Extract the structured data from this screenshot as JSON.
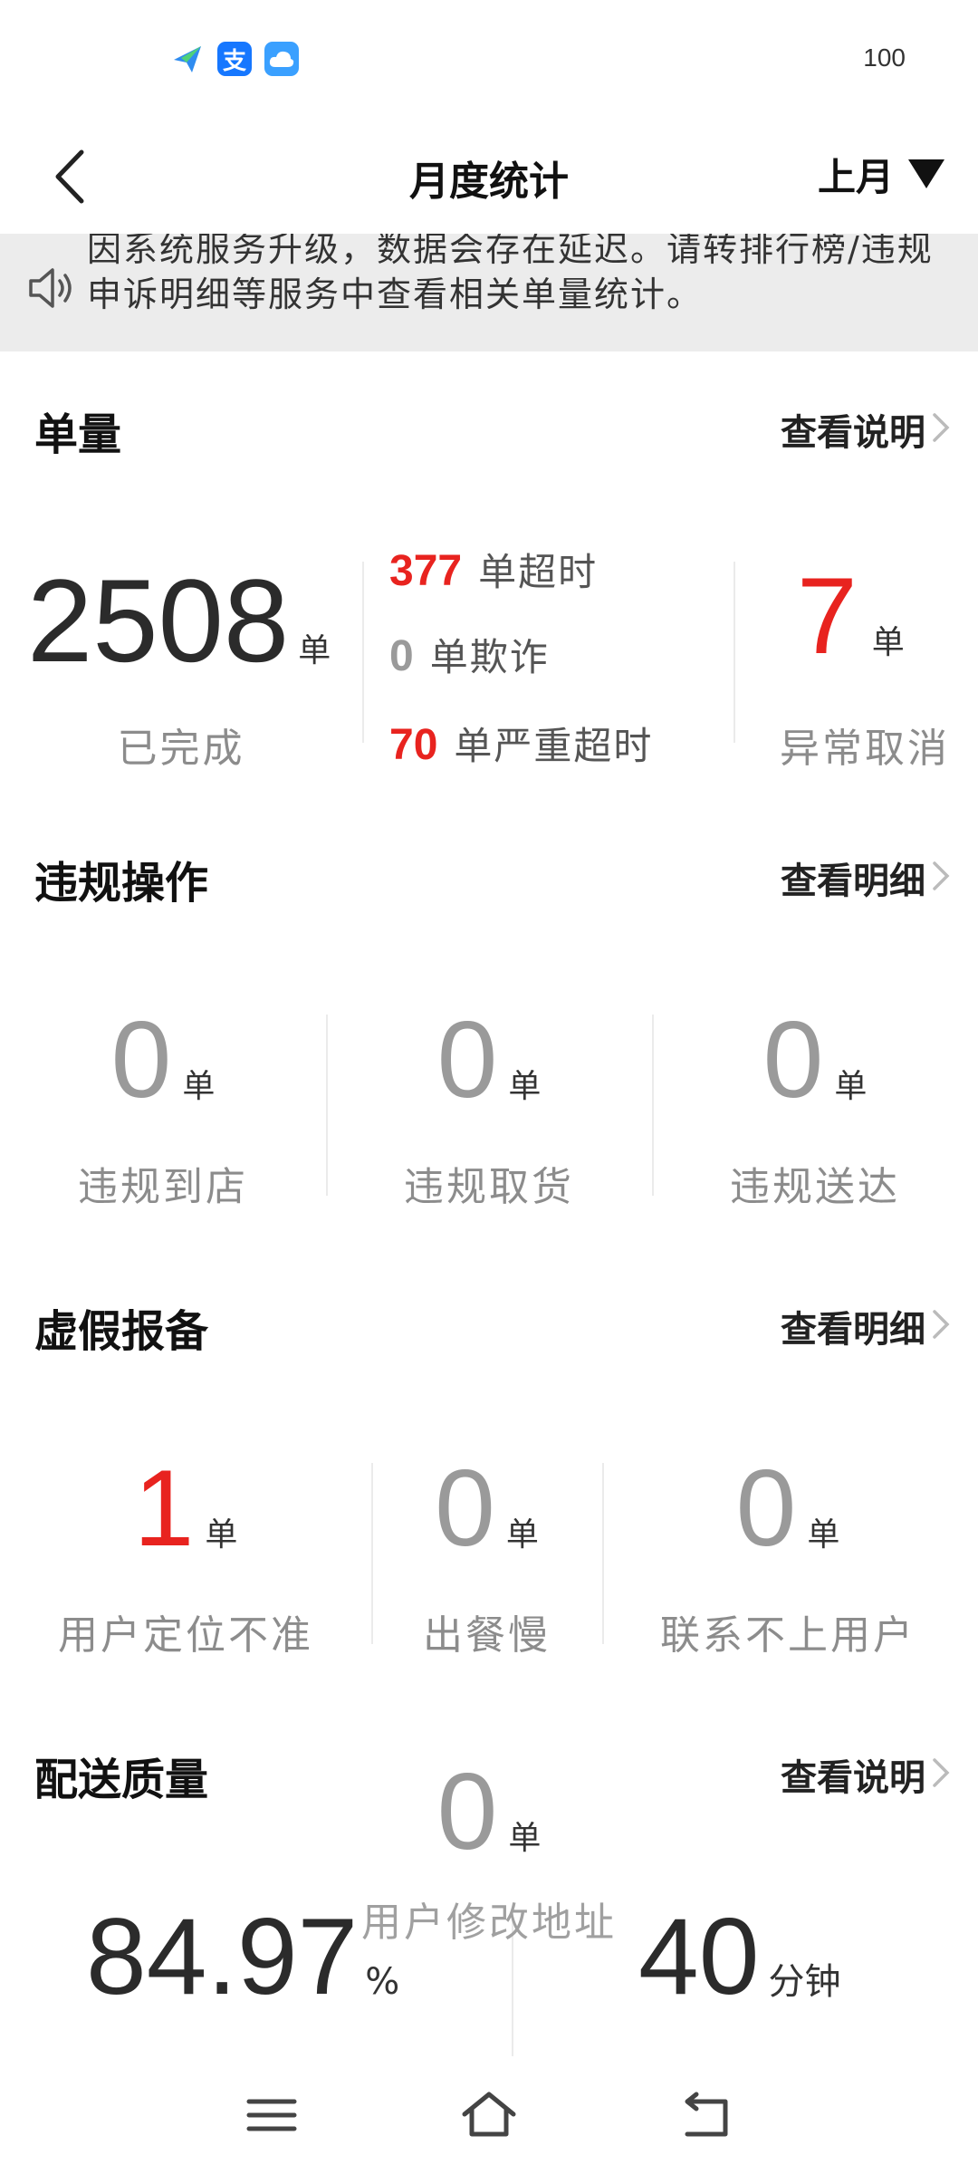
{
  "status_bar": {
    "icons": [
      "send-icon",
      "alipay-icon",
      "cloud-icon"
    ],
    "alipay_char": "支",
    "battery": "100"
  },
  "header": {
    "title": "月度统计",
    "month": "上月"
  },
  "notice": {
    "text": "因系统服务升级，数据会存在延迟。请转排行榜/违规申诉明细等服务中查看相关单量统计。"
  },
  "orders": {
    "title": "单量",
    "link": "查看说明",
    "completed": {
      "value": "2508",
      "unit": "单",
      "label": "已完成"
    },
    "overtime": {
      "value": "377",
      "label": "单超时"
    },
    "fraud": {
      "value": "0",
      "label": "单欺诈"
    },
    "severe_overtime": {
      "value": "70",
      "label": "单严重超时"
    },
    "abnormal_cancel": {
      "value": "7",
      "unit": "单",
      "label": "异常取消"
    }
  },
  "violations": {
    "title": "违规操作",
    "link": "查看明细",
    "items": [
      {
        "value": "0",
        "unit": "单",
        "label": "违规到店"
      },
      {
        "value": "0",
        "unit": "单",
        "label": "违规取货"
      },
      {
        "value": "0",
        "unit": "单",
        "label": "违规送达"
      }
    ]
  },
  "false_reports": {
    "title": "虚假报备",
    "link": "查看明细",
    "items": [
      {
        "value": "1",
        "unit": "单",
        "label": "用户定位不准"
      },
      {
        "value": "0",
        "unit": "单",
        "label": "出餐慢"
      },
      {
        "value": "0",
        "unit": "单",
        "label": "联系不上用户"
      },
      {
        "value": "0",
        "unit": "单",
        "label": "用户修改地址"
      }
    ]
  },
  "quality": {
    "title": "配送质量",
    "link": "查看说明",
    "rate": {
      "value": "84.97",
      "unit": "%"
    },
    "duration": {
      "value": "40",
      "unit": "分钟"
    }
  },
  "colors": {
    "red": "#e8231f",
    "gray_num": "#9a9a9a",
    "dark_num": "#2b2b2b"
  }
}
